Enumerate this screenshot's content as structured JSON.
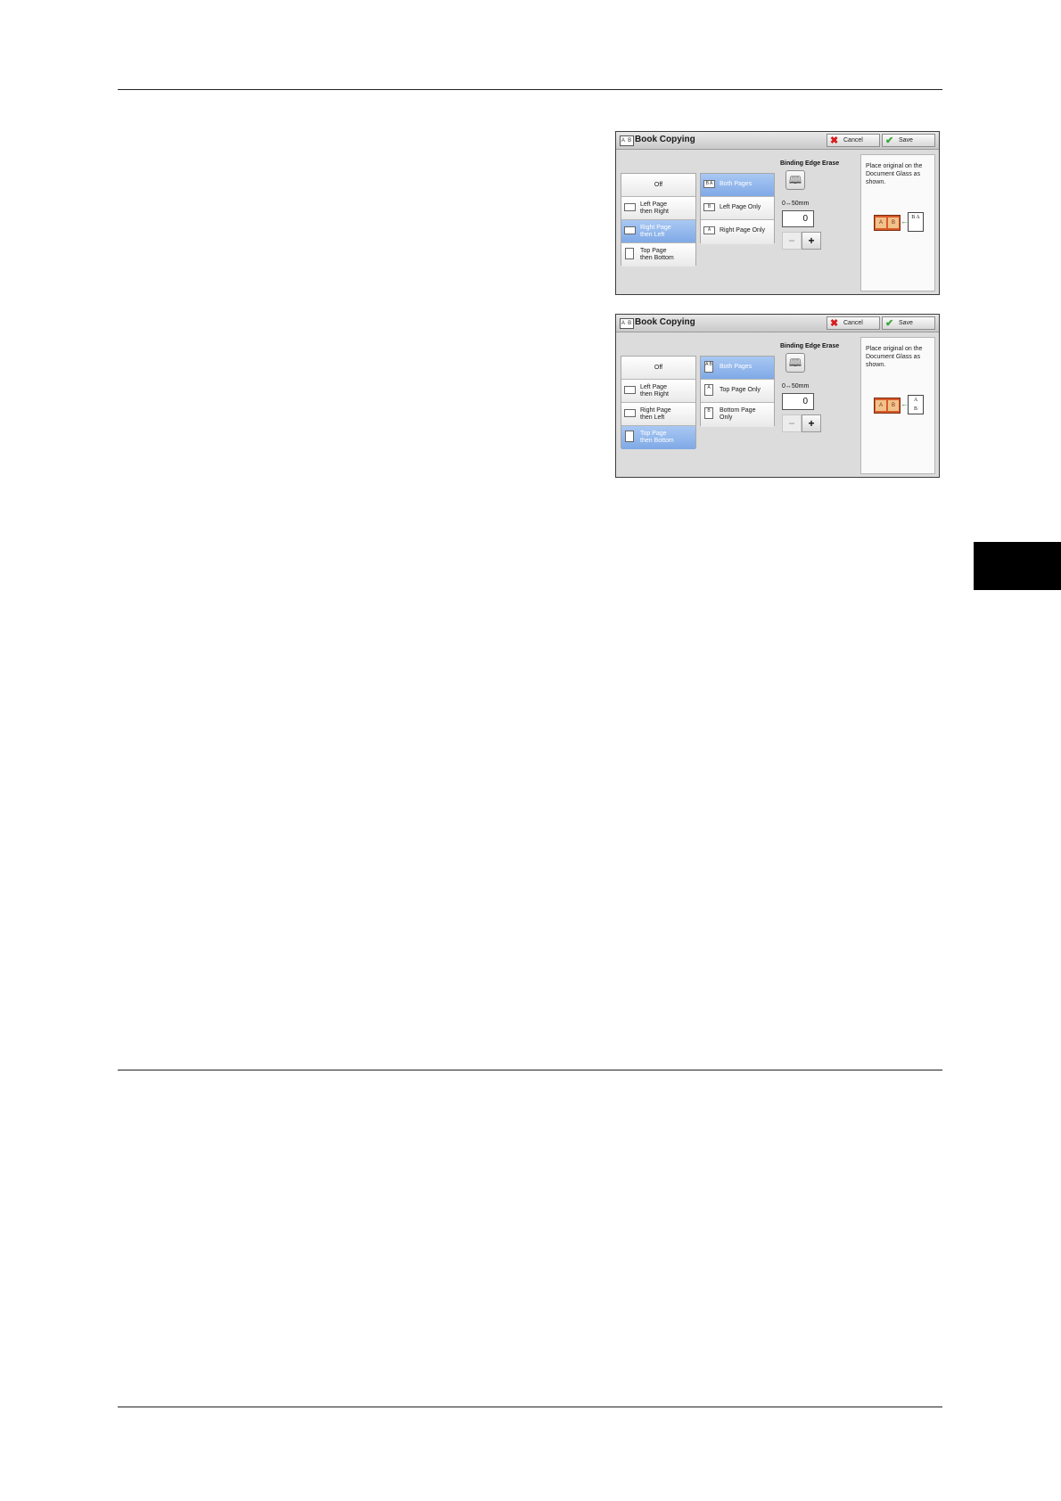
{
  "panels": [
    {
      "title": "Book Copying",
      "title_icon": "A B",
      "cancel": "Cancel",
      "save": "Save",
      "scan_options": [
        {
          "icon": "",
          "line1": "Off",
          "line2": "",
          "selected": false
        },
        {
          "icon": "book-icon",
          "line1": "Left Page",
          "line2": "then Right",
          "selected": false
        },
        {
          "icon": "book-icon",
          "line1": "Right Page",
          "line2": "then Left",
          "selected": true
        },
        {
          "icon": "page-icon",
          "line1": "Top Page",
          "line2": "then Bottom",
          "selected": false
        }
      ],
      "page_options": [
        {
          "icon_text": "B A",
          "line1": "Both Pages",
          "line2": "",
          "selected": true
        },
        {
          "icon_text": "B",
          "line1": "Left Page Only",
          "line2": "",
          "selected": false
        },
        {
          "icon_text": "A",
          "line1": "Right Page Only",
          "line2": "",
          "selected": false
        }
      ],
      "binding_label": "Binding Edge Erase",
      "range": "0↔50mm",
      "value": "0",
      "minus": "−",
      "plus": "+",
      "info": "Place original on the Document Glass as shown.",
      "diagram": {
        "glass": [
          "A",
          "B"
        ],
        "paper": [
          "B",
          "A"
        ]
      }
    },
    {
      "title": "Book Copying",
      "title_icon": "A B",
      "cancel": "Cancel",
      "save": "Save",
      "scan_options": [
        {
          "icon": "",
          "line1": "Off",
          "line2": "",
          "selected": false
        },
        {
          "icon": "book-icon",
          "line1": "Left Page",
          "line2": "then Right",
          "selected": false
        },
        {
          "icon": "book-icon",
          "line1": "Right Page",
          "line2": "then Left",
          "selected": false
        },
        {
          "icon": "page-icon",
          "line1": "Top Page",
          "line2": "then Bottom",
          "selected": true
        }
      ],
      "page_options": [
        {
          "icon_text": "A B",
          "line1": "Both Pages",
          "line2": "",
          "selected": true
        },
        {
          "icon_text": "A",
          "line1": "Top Page Only",
          "line2": "",
          "selected": false
        },
        {
          "icon_text": "B",
          "line1": "Bottom Page",
          "line2": "Only",
          "selected": false
        }
      ],
      "binding_label": "Binding Edge Erase",
      "range": "0↔50mm",
      "value": "0",
      "minus": "−",
      "plus": "+",
      "info": "Place original on the Document Glass as shown.",
      "diagram": {
        "glass": [
          "A",
          "B"
        ],
        "paper": [
          "A",
          "B"
        ]
      }
    }
  ]
}
